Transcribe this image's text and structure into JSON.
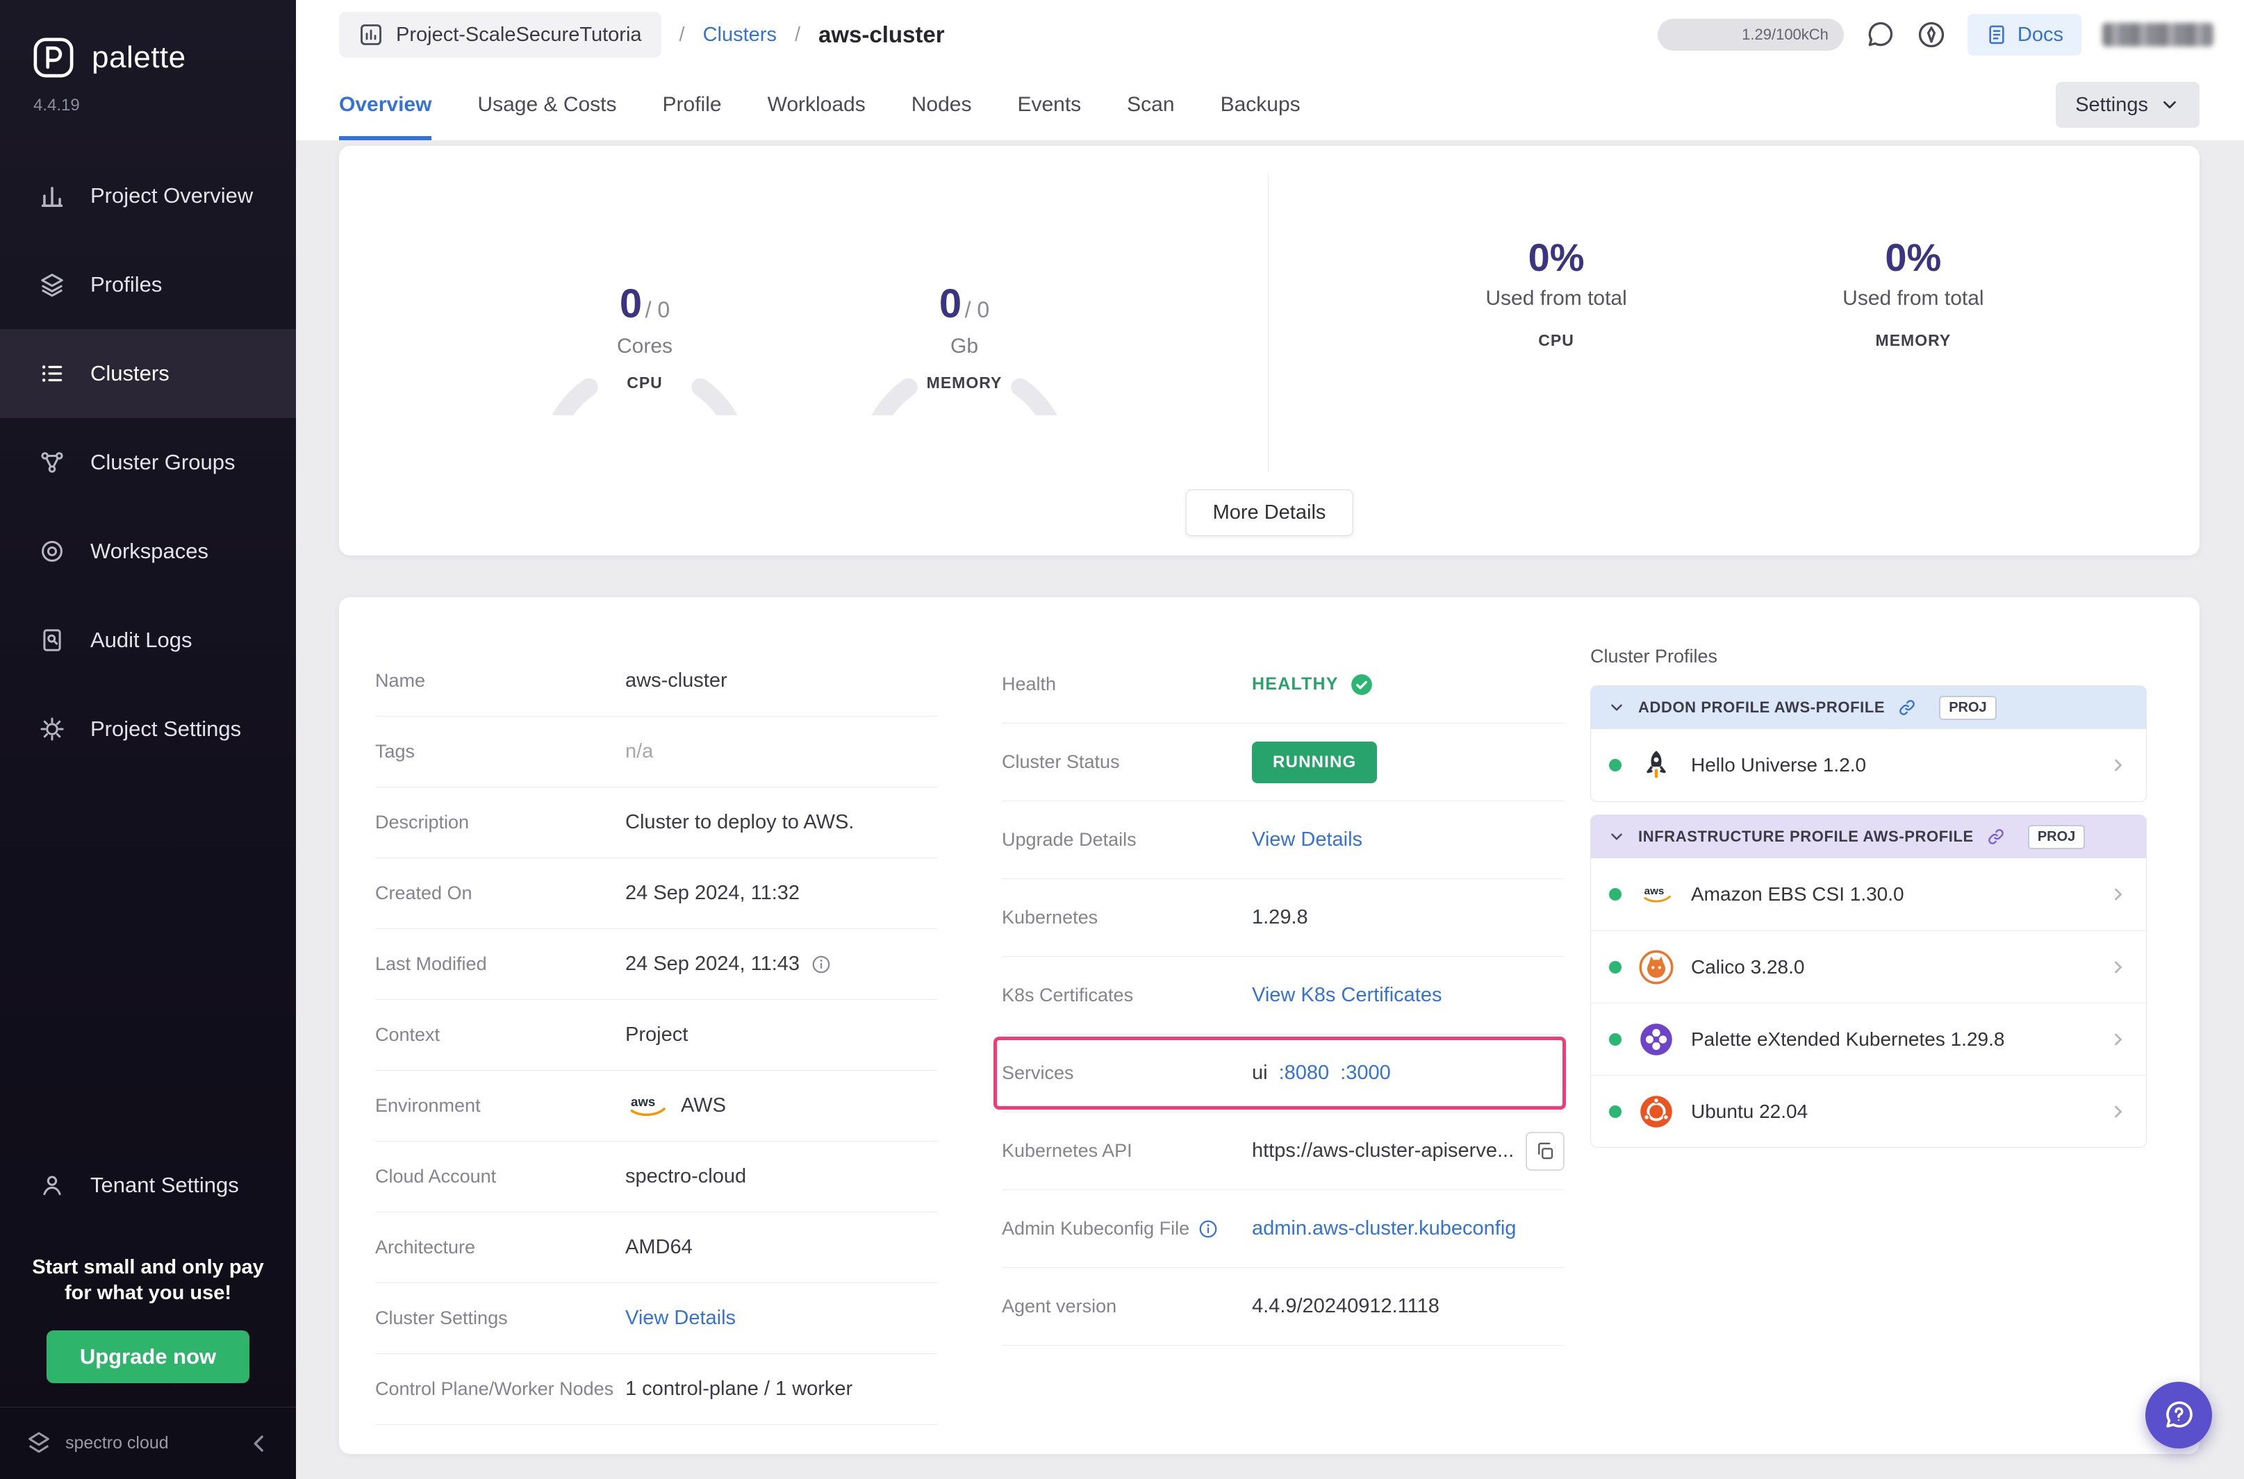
{
  "colors": {
    "accent_blue": "#3472D8",
    "green": "#27A36B",
    "pink_highlight": "#F23B78",
    "indigo_number": "#3B3480"
  },
  "sidebar": {
    "brand": "palette",
    "version": "4.4.19",
    "items": [
      "Project Overview",
      "Profiles",
      "Clusters",
      "Cluster Groups",
      "Workspaces",
      "Audit Logs",
      "Project Settings"
    ],
    "tenant_settings": "Tenant Settings",
    "promo": {
      "line1": "Start small and only pay",
      "line2": "for what you use!",
      "button": "Upgrade now"
    },
    "footer_brand": "spectro cloud"
  },
  "header": {
    "project_selector": "Project-ScaleSecureTutoria",
    "breadcrumb": {
      "sep": "/",
      "clusters": "Clusters",
      "current": "aws-cluster"
    },
    "usage_pill": "1.29/100kCh",
    "docs": "Docs"
  },
  "tabs": {
    "labels": [
      "Overview",
      "Usage & Costs",
      "Profile",
      "Workloads",
      "Nodes",
      "Events",
      "Scan",
      "Backups"
    ],
    "settings": "Settings"
  },
  "overview_card": {
    "cpu_gauge": {
      "used": "0",
      "sep": "/ ",
      "total": "0",
      "unit": "Cores",
      "label": "CPU"
    },
    "memory_gauge": {
      "used": "0",
      "sep": "/ ",
      "total": "0",
      "unit": "Gb",
      "label": "MEMORY"
    },
    "cpu_stat": {
      "pct": "0%",
      "caption": "Used from total",
      "label": "CPU"
    },
    "memory_stat": {
      "pct": "0%",
      "caption": "Used from total",
      "label": "MEMORY"
    },
    "more_details": "More Details"
  },
  "details": {
    "rows_left": [
      {
        "label": "Name",
        "value": "aws-cluster"
      },
      {
        "label": "Tags",
        "value": "n/a"
      },
      {
        "label": "Description",
        "value": "Cluster to deploy to AWS."
      },
      {
        "label": "Created On",
        "value": "24 Sep 2024, 11:32"
      },
      {
        "label": "Last Modified",
        "value": "24 Sep 2024, 11:43"
      },
      {
        "label": "Context",
        "value": "Project"
      },
      {
        "label": "Environment",
        "value": "AWS"
      },
      {
        "label": "Cloud Account",
        "value": "spectro-cloud"
      },
      {
        "label": "Architecture",
        "value": "AMD64"
      },
      {
        "label": "Cluster Settings",
        "value": "View Details"
      },
      {
        "label": "Control Plane/Worker Nodes",
        "value": "1 control-plane / 1 worker"
      }
    ],
    "health": {
      "label": "Health",
      "value": "HEALTHY"
    },
    "cluster_status": {
      "label": "Cluster Status",
      "value": "RUNNING"
    },
    "upgrade": {
      "label": "Upgrade Details",
      "value": "View Details"
    },
    "kubernetes": {
      "label": "Kubernetes",
      "value": "1.29.8"
    },
    "k8s_certs": {
      "label": "K8s Certificates",
      "value": "View K8s Certificates"
    },
    "services": {
      "label": "Services",
      "name": "ui",
      "port1": ":8080",
      "port2": ":3000"
    },
    "kube_api": {
      "label": "Kubernetes API",
      "value": "https://aws-cluster-apiserve..."
    },
    "kubeconfig": {
      "label": "Admin Kubeconfig File",
      "value": "admin.aws-cluster.kubeconfig"
    },
    "agent": {
      "label": "Agent version",
      "value": "4.4.9/20240912.1118"
    }
  },
  "profiles_panel": {
    "title": "Cluster Profiles",
    "groups": [
      {
        "label": "ADDON PROFILE AWS-PROFILE",
        "badge": "PROJ",
        "items": [
          {
            "name": "Hello Universe 1.2.0"
          }
        ]
      },
      {
        "label": "INFRASTRUCTURE PROFILE AWS-PROFILE",
        "badge": "PROJ",
        "items": [
          {
            "name": "Amazon EBS CSI 1.30.0"
          },
          {
            "name": "Calico 3.28.0"
          },
          {
            "name": "Palette eXtended Kubernetes 1.29.8"
          },
          {
            "name": "Ubuntu 22.04"
          }
        ]
      }
    ]
  }
}
